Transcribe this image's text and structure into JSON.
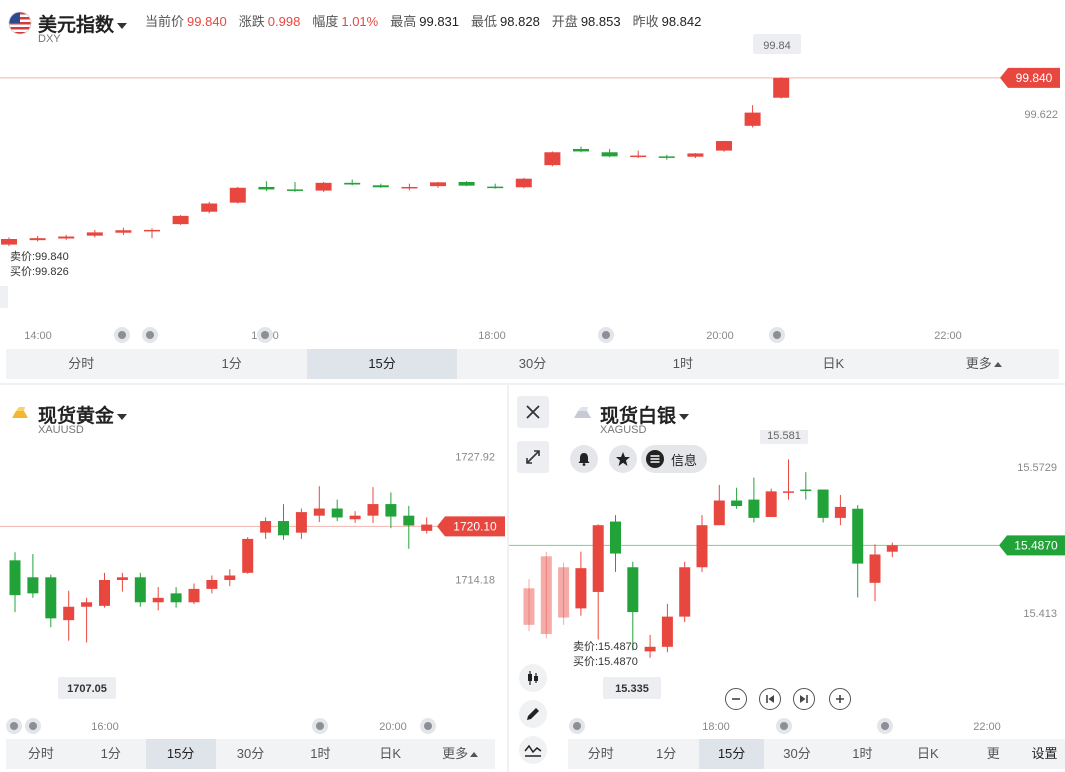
{
  "top": {
    "title": "美元指数",
    "symbol": "DXY",
    "quote": [
      {
        "k": "当前价",
        "v": "99.840",
        "up": true
      },
      {
        "k": "涨跌",
        "v": "0.998",
        "up": true
      },
      {
        "k": "幅度",
        "v": "1.01%",
        "up": true
      },
      {
        "k": "最高",
        "v": "99.831",
        "up": false
      },
      {
        "k": "最低",
        "v": "98.828",
        "up": false
      },
      {
        "k": "开盘",
        "v": "98.853",
        "up": false
      },
      {
        "k": "昨收",
        "v": "98.842",
        "up": false
      }
    ],
    "sell": "卖价:99.840",
    "buy": "买价:99.826",
    "tabs": [
      "分时",
      "1分",
      "15分",
      "30分",
      "1时",
      "日K",
      "更多"
    ]
  },
  "gold": {
    "title": "现货黄金",
    "symbol": "XAUUSD",
    "tabs": [
      "分时",
      "1分",
      "15分",
      "30分",
      "1时",
      "日K",
      "更多"
    ]
  },
  "silver": {
    "title": "现货白银",
    "symbol": "XAGUSD",
    "info_label": "信息",
    "sell": "卖价:15.4870",
    "buy": "买价:15.4870",
    "tabs": [
      "分时",
      "1分",
      "15分",
      "30分",
      "1时",
      "日K",
      "更"
    ],
    "settings_label": "设置"
  },
  "colors": {
    "up": "#e8473f",
    "down": "#22a33a"
  },
  "icons": [
    "close-icon",
    "expand-icon",
    "bell-icon",
    "star-icon",
    "menu-icon",
    "minus-icon",
    "first-icon",
    "last-icon",
    "plus-icon",
    "candlestick-icon",
    "pen-icon",
    "indicator-icon",
    "flag-icon"
  ],
  "chart_data": [
    {
      "type": "candlestick",
      "title": "美元指数",
      "x_ticks": [
        "14:00",
        "16:00",
        "18:00",
        "20:00",
        "22:00"
      ],
      "y_ticks": [
        99.622
      ],
      "ylim": [
        98.75,
        99.9
      ],
      "current_price": "99.840",
      "high_label": "99.84",
      "candles": [
        {
          "o": 98.831,
          "c": 98.865,
          "h": 98.875,
          "l": 98.822
        },
        {
          "o": 98.858,
          "c": 98.87,
          "h": 98.883,
          "l": 98.85
        },
        {
          "o": 98.868,
          "c": 98.88,
          "h": 98.89,
          "l": 98.86
        },
        {
          "o": 98.885,
          "c": 98.905,
          "h": 98.92,
          "l": 98.875
        },
        {
          "o": 98.903,
          "c": 98.918,
          "h": 98.933,
          "l": 98.89
        },
        {
          "o": 98.915,
          "c": 98.92,
          "h": 98.93,
          "l": 98.87
        },
        {
          "o": 98.955,
          "c": 99.005,
          "h": 99.01,
          "l": 98.95
        },
        {
          "o": 99.03,
          "c": 99.08,
          "h": 99.09,
          "l": 99.02
        },
        {
          "o": 99.085,
          "c": 99.175,
          "h": 99.18,
          "l": 99.08
        },
        {
          "o": 99.18,
          "c": 99.165,
          "h": 99.215,
          "l": 99.155
        },
        {
          "o": 99.165,
          "c": 99.158,
          "h": 99.21,
          "l": 99.15
        },
        {
          "o": 99.158,
          "c": 99.205,
          "h": 99.21,
          "l": 99.15
        },
        {
          "o": 99.205,
          "c": 99.195,
          "h": 99.225,
          "l": 99.19
        },
        {
          "o": 99.19,
          "c": 99.178,
          "h": 99.2,
          "l": 99.175
        },
        {
          "o": 99.18,
          "c": 99.18,
          "h": 99.2,
          "l": 99.16
        },
        {
          "o": 99.185,
          "c": 99.208,
          "h": 99.21,
          "l": 99.175
        },
        {
          "o": 99.21,
          "c": 99.188,
          "h": 99.215,
          "l": 99.185
        },
        {
          "o": 99.182,
          "c": 99.18,
          "h": 99.2,
          "l": 99.17
        },
        {
          "o": 99.178,
          "c": 99.23,
          "h": 99.235,
          "l": 99.172
        },
        {
          "o": 99.312,
          "c": 99.39,
          "h": 99.395,
          "l": 99.305
        },
        {
          "o": 99.41,
          "c": 99.395,
          "h": 99.425,
          "l": 99.39
        },
        {
          "o": 99.39,
          "c": 99.365,
          "h": 99.41,
          "l": 99.36
        },
        {
          "o": 99.37,
          "c": 99.37,
          "h": 99.4,
          "l": 99.355
        },
        {
          "o": 99.365,
          "c": 99.358,
          "h": 99.375,
          "l": 99.345
        },
        {
          "o": 99.363,
          "c": 99.383,
          "h": 99.385,
          "l": 99.355
        },
        {
          "o": 99.4,
          "c": 99.458,
          "h": 99.46,
          "l": 99.393
        },
        {
          "o": 99.55,
          "c": 99.63,
          "h": 99.675,
          "l": 99.54
        },
        {
          "o": 99.72,
          "c": 99.84,
          "h": 99.843,
          "l": 99.715
        }
      ]
    },
    {
      "type": "candlestick",
      "title": "现货黄金",
      "x_ticks": [
        "16:00",
        "20:00"
      ],
      "y_ticks": [
        1727.92,
        1714.18
      ],
      "ylim": [
        1702,
        1730
      ],
      "current_price": "1720.10",
      "high_label": "",
      "low_label": "1707.05",
      "candles": [
        {
          "o": 1716.3,
          "c": 1712.4,
          "h": 1717.2,
          "l": 1710.5
        },
        {
          "o": 1714.4,
          "c": 1712.6,
          "h": 1717.0,
          "l": 1712.1
        },
        {
          "o": 1714.4,
          "c": 1709.8,
          "h": 1714.7,
          "l": 1708.8
        },
        {
          "o": 1709.6,
          "c": 1711.1,
          "h": 1712.9,
          "l": 1707.3
        },
        {
          "o": 1711.1,
          "c": 1711.6,
          "h": 1712.1,
          "l": 1707.1
        },
        {
          "o": 1711.2,
          "c": 1714.1,
          "h": 1714.9,
          "l": 1711.0
        },
        {
          "o": 1714.1,
          "c": 1714.4,
          "h": 1714.9,
          "l": 1712.8
        },
        {
          "o": 1714.4,
          "c": 1711.6,
          "h": 1714.9,
          "l": 1711.1
        },
        {
          "o": 1711.6,
          "c": 1712.1,
          "h": 1713.3,
          "l": 1710.7
        },
        {
          "o": 1712.6,
          "c": 1711.6,
          "h": 1713.3,
          "l": 1711.0
        },
        {
          "o": 1711.6,
          "c": 1713.1,
          "h": 1713.7,
          "l": 1711.4
        },
        {
          "o": 1713.1,
          "c": 1714.1,
          "h": 1714.6,
          "l": 1712.6
        },
        {
          "o": 1714.1,
          "c": 1714.6,
          "h": 1715.3,
          "l": 1713.4
        },
        {
          "o": 1714.9,
          "c": 1718.7,
          "h": 1718.9,
          "l": 1714.8
        },
        {
          "o": 1719.4,
          "c": 1720.7,
          "h": 1721.1,
          "l": 1718.7
        },
        {
          "o": 1720.7,
          "c": 1719.1,
          "h": 1722.6,
          "l": 1718.6
        },
        {
          "o": 1719.4,
          "c": 1721.7,
          "h": 1722.1,
          "l": 1718.7
        },
        {
          "o": 1721.3,
          "c": 1722.1,
          "h": 1724.6,
          "l": 1720.6
        },
        {
          "o": 1722.1,
          "c": 1721.1,
          "h": 1723.1,
          "l": 1720.7
        },
        {
          "o": 1720.9,
          "c": 1721.3,
          "h": 1721.8,
          "l": 1720.5
        },
        {
          "o": 1721.3,
          "c": 1722.6,
          "h": 1724.5,
          "l": 1720.5
        },
        {
          "o": 1722.6,
          "c": 1721.2,
          "h": 1723.9,
          "l": 1719.9
        },
        {
          "o": 1721.3,
          "c": 1720.2,
          "h": 1722.4,
          "l": 1717.6
        },
        {
          "o": 1719.6,
          "c": 1720.3,
          "h": 1721.1,
          "l": 1719.3
        }
      ]
    },
    {
      "type": "candlestick",
      "title": "现货白银",
      "x_ticks": [
        "18:00",
        "22:00"
      ],
      "y_ticks": [
        15.5729,
        15.413
      ],
      "ylim": [
        15.32,
        15.6
      ],
      "current_price": "15.4870",
      "high_label": "15.581",
      "low_label": "15.335",
      "candles": [
        {
          "o": 15.4,
          "c": 15.44,
          "h": 15.45,
          "l": 15.393
        },
        {
          "o": 15.39,
          "c": 15.475,
          "h": 15.48,
          "l": 15.385
        },
        {
          "o": 15.408,
          "c": 15.463,
          "h": 15.468,
          "l": 15.4
        },
        {
          "o": 15.418,
          "c": 15.462,
          "h": 15.48,
          "l": 15.41
        },
        {
          "o": 15.436,
          "c": 15.509,
          "h": 15.51,
          "l": 15.384
        },
        {
          "o": 15.513,
          "c": 15.478,
          "h": 15.52,
          "l": 15.458
        },
        {
          "o": 15.463,
          "c": 15.414,
          "h": 15.469,
          "l": 15.372
        },
        {
          "o": 15.371,
          "c": 15.376,
          "h": 15.389,
          "l": 15.364
        },
        {
          "o": 15.376,
          "c": 15.409,
          "h": 15.423,
          "l": 15.37
        },
        {
          "o": 15.409,
          "c": 15.463,
          "h": 15.469,
          "l": 15.403
        },
        {
          "o": 15.463,
          "c": 15.509,
          "h": 15.52,
          "l": 15.458
        },
        {
          "o": 15.509,
          "c": 15.536,
          "h": 15.553,
          "l": 15.509
        },
        {
          "o": 15.536,
          "c": 15.53,
          "h": 15.55,
          "l": 15.527
        },
        {
          "o": 15.537,
          "c": 15.517,
          "h": 15.561,
          "l": 15.512
        },
        {
          "o": 15.518,
          "c": 15.546,
          "h": 15.549,
          "l": 15.518
        },
        {
          "o": 15.546,
          "c": 15.546,
          "h": 15.581,
          "l": 15.537
        },
        {
          "o": 15.548,
          "c": 15.547,
          "h": 15.567,
          "l": 15.537
        },
        {
          "o": 15.548,
          "c": 15.517,
          "h": 15.548,
          "l": 15.512
        },
        {
          "o": 15.517,
          "c": 15.529,
          "h": 15.542,
          "l": 15.509
        },
        {
          "o": 15.527,
          "c": 15.467,
          "h": 15.531,
          "l": 15.43
        },
        {
          "o": 15.446,
          "c": 15.477,
          "h": 15.488,
          "l": 15.426
        },
        {
          "o": 15.48,
          "c": 15.487,
          "h": 15.49,
          "l": 15.474
        }
      ]
    }
  ]
}
